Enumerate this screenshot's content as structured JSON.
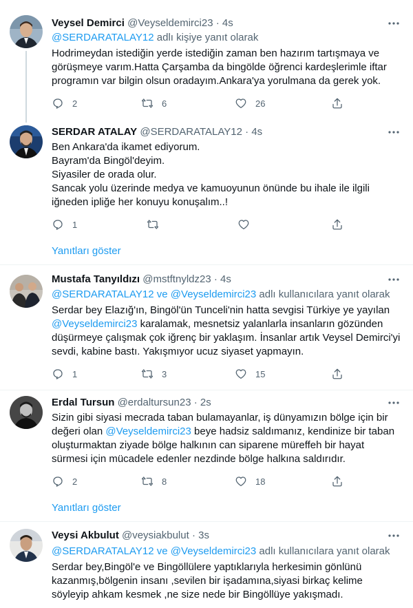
{
  "tweets": [
    {
      "name": "Veysel Demirci",
      "handle": "@Veyseldemirci23",
      "dot": "·",
      "time": "4s",
      "reply_prefix": "@SERDARATALAY12",
      "reply_suffix": " adlı kişiye yanıt olarak",
      "body": "Hodrimeydan istediğin yerde istediğin zaman ben hazırım tartışmaya ve görüşmeye varım.Hatta Çarşamba da bingölde öğrenci kardeşlerimle iftar programın var bilgin olsun oradayım.Ankara'ya yorulmana da gerek yok.",
      "replies": "2",
      "retweets": "6",
      "likes": "26"
    },
    {
      "name": "SERDAR ATALAY",
      "handle": "@SERDARATALAY12",
      "dot": "·",
      "time": "4s",
      "body_lines": [
        "Ben Ankara'da ikamet ediyorum.",
        "Bayram'da Bingöl'deyim.",
        "Siyasiler de orada olur.",
        "Sancak yolu üzerinde medya ve kamuoyunun önünde bu ihale ile ilgili iğneden ipliğe her konuyu konuşalım..!"
      ],
      "replies": "1",
      "retweets": "",
      "likes": ""
    },
    {
      "name": "Mustafa Tanyıldızı",
      "handle": "@mstftnyldz23",
      "dot": "·",
      "time": "4s",
      "reply_user1": "@SERDARATALAY12",
      "reply_and": " ve ",
      "reply_user2": "@Veyseldemirci23",
      "reply_suffix": " adlı kullanıcılara yanıt olarak",
      "body_a": "Serdar bey Elazığ'ın, Bingöl'ün Tunceli'nin hatta sevgisi Türkiye ye yayılan ",
      "body_mention": "@Veyseldemirci23",
      "body_b": " karalamak, mesnetsiz yalanlarla insanların gözünden düşürmeye çalışmak çok iğrenç bir yaklaşım. İnsanlar artık Veysel Demirci'yi sevdi, kabine bastı. Yakışmıyor ucuz siyaset yapmayın.",
      "replies": "1",
      "retweets": "3",
      "likes": "15"
    },
    {
      "name": "Erdal Tursun",
      "handle": "@erdaltursun23",
      "dot": "·",
      "time": "2s",
      "body_a": "Sizin gibi siyasi mecrada taban bulamayanlar, iş dünyamızın bölge için bir değeri olan ",
      "body_mention": "@Veyseldemirci23",
      "body_b": " beye hadsiz saldımanız, kendinize bir taban oluşturmaktan ziyade bölge halkının can siparene müreffeh bir hayat sürmesi için mücadele edenler nezdinde bölge halkına saldırıdır.",
      "replies": "2",
      "retweets": "8",
      "likes": "18"
    },
    {
      "name": "Veysi Akbulut",
      "handle": "@veysiakbulut",
      "dot": "·",
      "time": "3s",
      "reply_user1": "@SERDARATALAY12",
      "reply_and": " ve ",
      "reply_user2": "@Veyseldemirci23",
      "reply_suffix": " adlı kullanıcılara yanıt olarak",
      "body": "Serdar bey,Bingöl'e ve Bingöllülere yaptıklarıyla herkesimin gönlünü kazanmış,bölgenin insanı ,sevilen bir işadamına,siyasi birkaç kelime söyleyip ahkam kesmek ,ne size nede bir Bingöllüye yakışmadı."
    }
  ],
  "show_replies_label": "Yanıtları göster",
  "colors": {
    "accent": "#1d9bf0",
    "secondary_text": "#536471",
    "divider": "#eff3f4",
    "thread_line": "#cfd9de"
  }
}
